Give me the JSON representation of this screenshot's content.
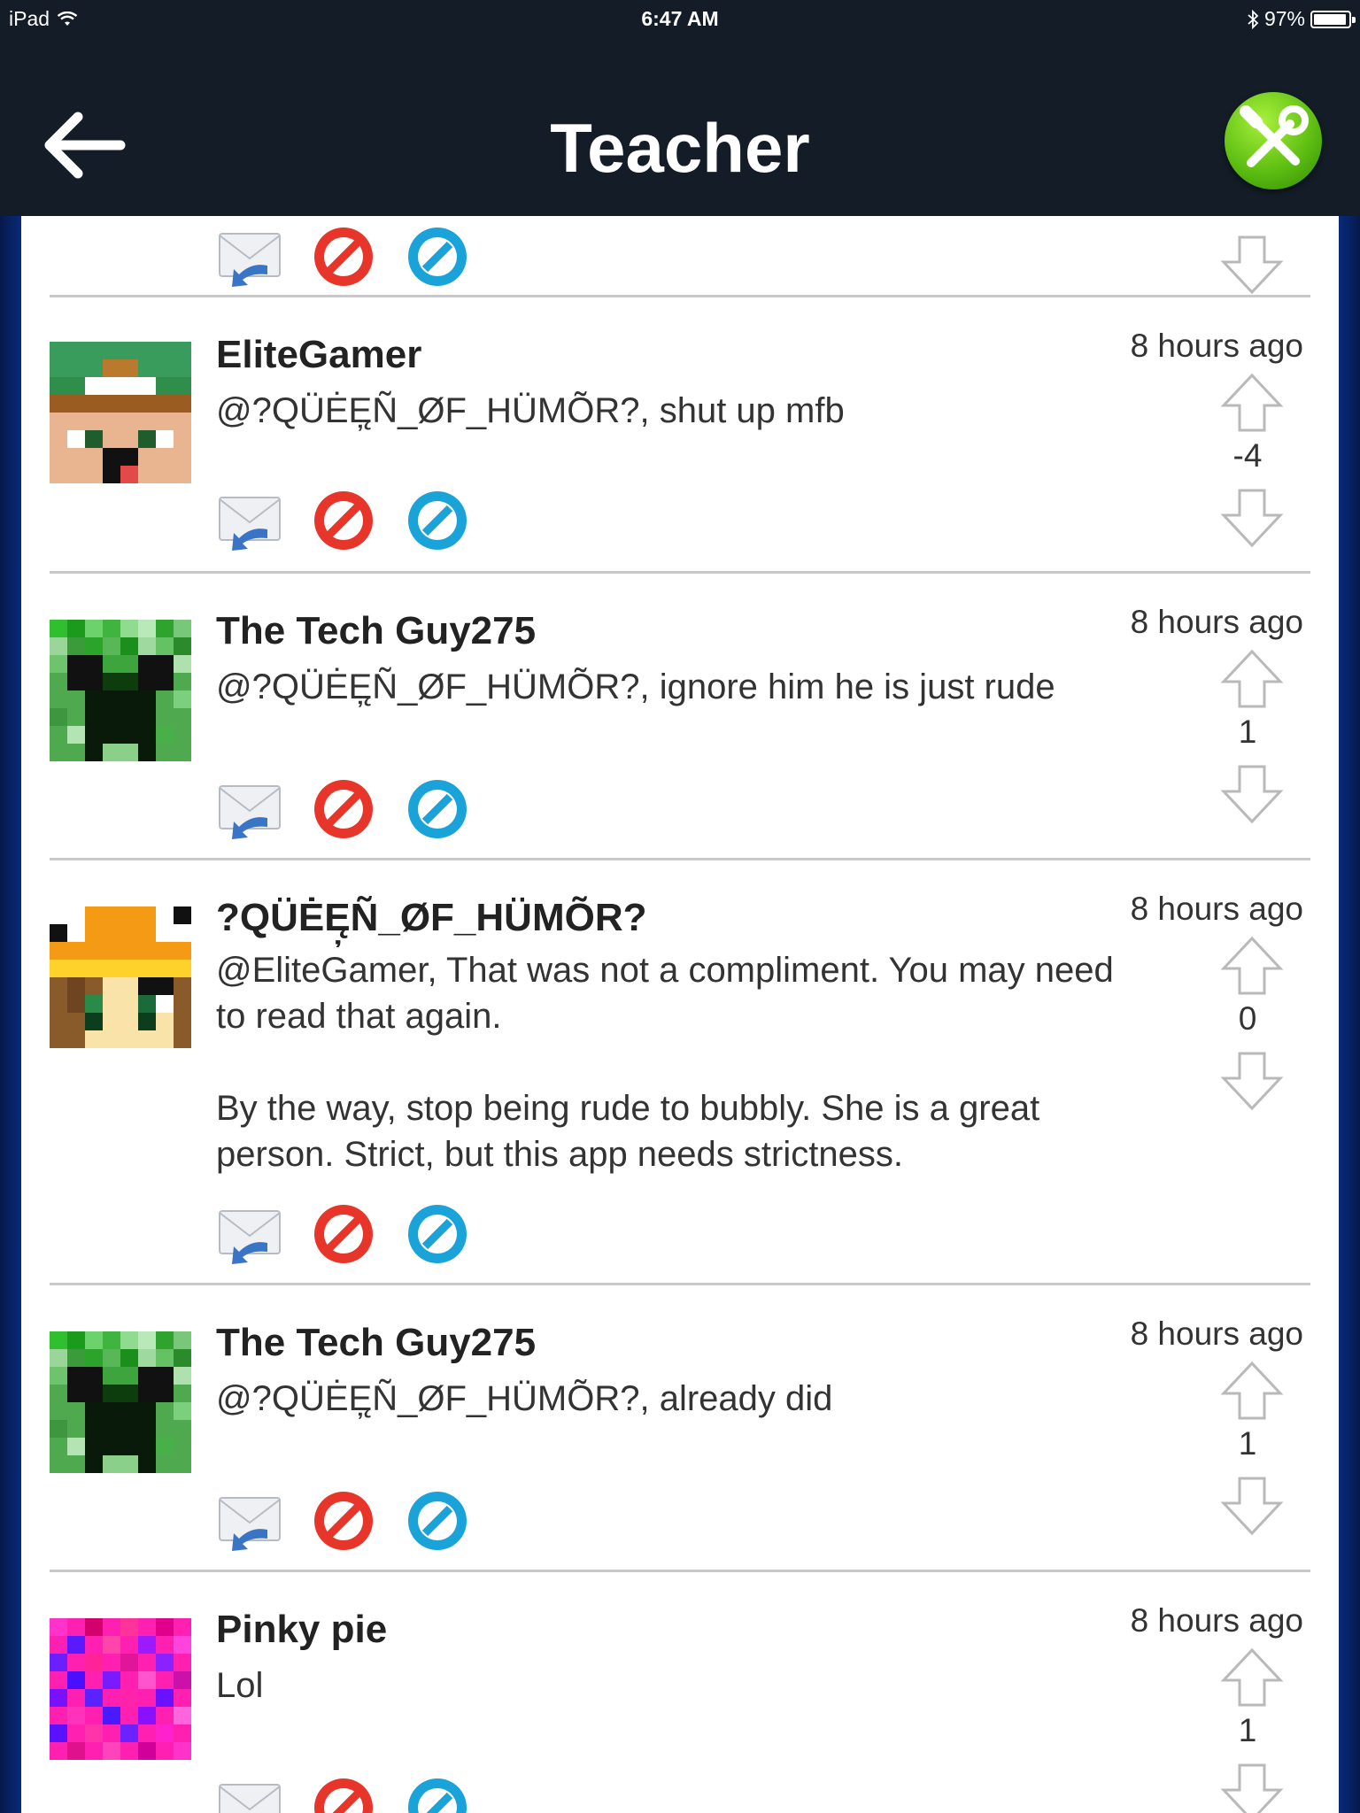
{
  "statusbar": {
    "device": "iPad",
    "time": "6:47 AM",
    "battery": "97%"
  },
  "navbar": {
    "title": "Teacher"
  },
  "colors": {
    "navbar_bg": "#131c27",
    "reply_blue": "#3a74c4",
    "flag_red": "#e8352a",
    "block_blue": "#1aa3d8",
    "tools_green": "#5fbf12"
  },
  "comments": [
    {
      "username": "EliteGamer",
      "message": "@?QÜĖĘ̦Ñ_ØF_HÜMÕR?, shut up mfb",
      "time": "8 hours ago",
      "score": "-4"
    },
    {
      "username": "The Tech Guy275",
      "message": "@?QÜĖĘ̦Ñ_ØF_HÜMÕR?, ignore him he is just rude",
      "time": "8 hours ago",
      "score": "1"
    },
    {
      "username": "?QÜĖĘ̦Ñ_ØF_HÜMÕR?",
      "message": "@EliteGamer, That was not a compliment. You may need to read that again.\n\nBy the way, stop being rude to bubbly. She is a great person. Strict, but this app needs strictness.",
      "time": "8 hours ago",
      "score": "0"
    },
    {
      "username": "The Tech Guy275",
      "message": "@?QÜĖĘ̦Ñ_ØF_HÜMÕR?, already did",
      "time": "8 hours ago",
      "score": "1"
    },
    {
      "username": "Pinky pie",
      "message": "Lol",
      "time": "8 hours ago",
      "score": "1"
    }
  ]
}
